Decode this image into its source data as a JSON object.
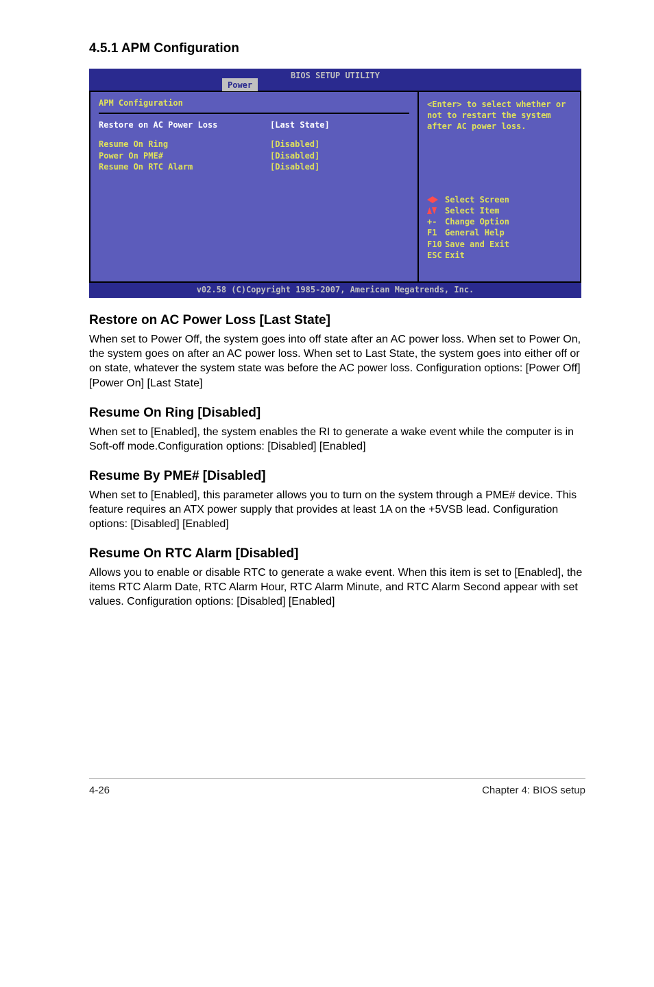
{
  "section_title": "4.5.1 APM Configuration",
  "bios": {
    "header_title": "BIOS SETUP UTILITY",
    "tab": "Power",
    "panel_title": "APM Configuration",
    "rows": [
      {
        "label": "Restore on AC Power Loss",
        "value": "[Last State]",
        "highlight": true
      },
      {
        "label": "Resume On Ring",
        "value": "[Disabled]",
        "highlight": false
      },
      {
        "label": "Power On PME#",
        "value": "[Disabled]",
        "highlight": false
      },
      {
        "label": "Resume On RTC Alarm",
        "value": "[Disabled]",
        "highlight": false
      }
    ],
    "help_text": "<Enter> to select whether or not to restart the system after AC power loss.",
    "nav": {
      "select_screen": "Select Screen",
      "select_item": "Select Item",
      "change_option_key": "+-",
      "change_option": "Change Option",
      "general_help_key": "F1",
      "general_help": "General Help",
      "save_exit_key": "F10",
      "save_exit": "Save and Exit",
      "esc_key": "ESC",
      "esc": "Exit"
    },
    "footer": "v02.58 (C)Copyright 1985-2007, American Megatrends, Inc."
  },
  "content": {
    "restore_title": "Restore on AC Power Loss [Last State]",
    "restore_body": "When set to Power Off, the system goes into off state after an AC power loss. When set to Power On, the system goes on after an AC power loss. When set to Last State, the system goes into either off or on state, whatever the system state was before the AC power loss. Configuration options: [Power Off] [Power On] [Last State]",
    "ring_title": "Resume On Ring [Disabled]",
    "ring_body": "When set to [Enabled], the system enables the RI to generate a wake event while the computer is in Soft-off mode.Configuration options: [Disabled] [Enabled]",
    "pme_title": "Resume By PME# [Disabled]",
    "pme_body": "When set to [Enabled], this parameter allows you to turn on the system through a PME# device. This feature requires an ATX power supply that provides at least 1A on the +5VSB lead. Configuration options: [Disabled] [Enabled]",
    "rtc_title": "Resume On RTC Alarm [Disabled]",
    "rtc_body": "Allows you to enable or disable RTC to generate a wake event. When this item is set to [Enabled], the items RTC Alarm Date, RTC Alarm Hour, RTC Alarm Minute, and RTC Alarm Second appear with set values. Configuration options: [Disabled] [Enabled]"
  },
  "footer": {
    "left": "4-26",
    "right": "Chapter 4: BIOS setup"
  }
}
